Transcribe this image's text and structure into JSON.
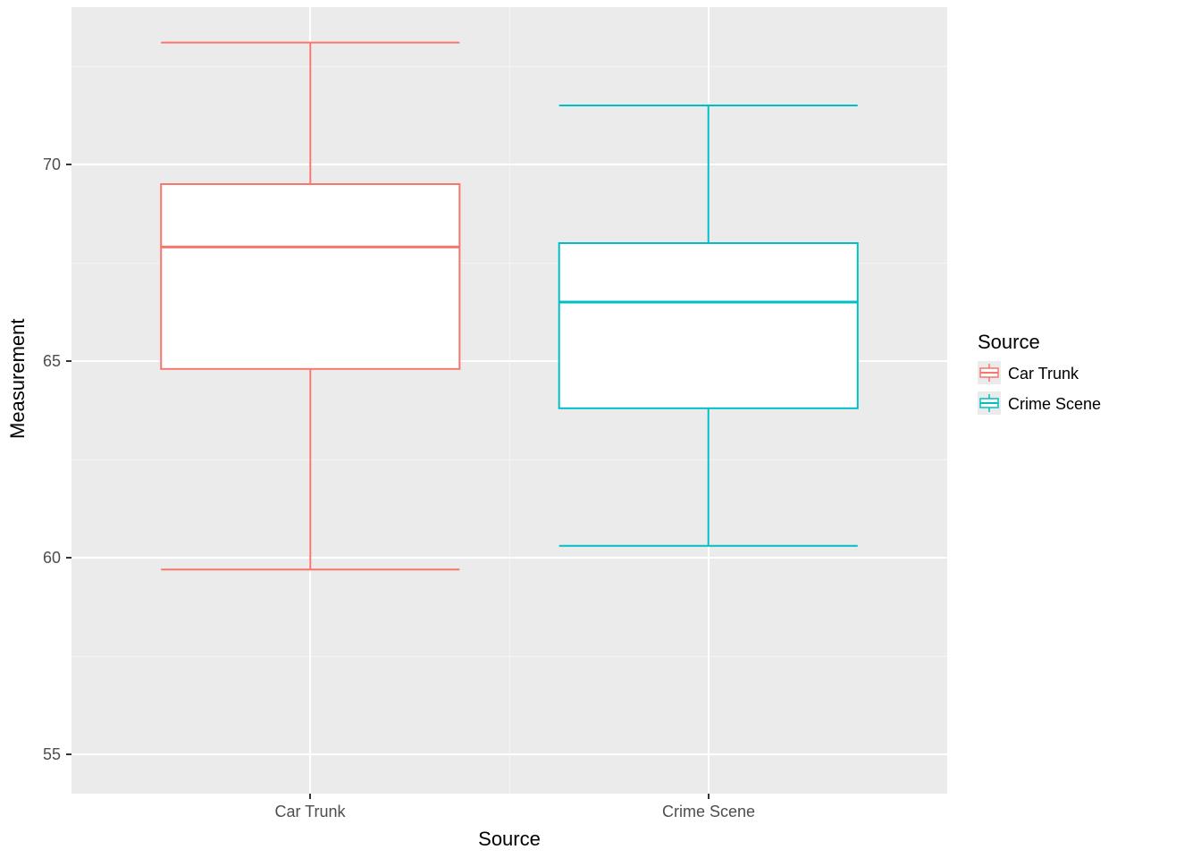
{
  "chart_data": {
    "type": "boxplot",
    "xlabel": "Source",
    "ylabel": "Measurement",
    "categories": [
      "Car Trunk",
      "Crime Scene"
    ],
    "y_ticks": [
      55,
      60,
      65,
      70
    ],
    "ylim": [
      54,
      74
    ],
    "series": [
      {
        "name": "Car Trunk",
        "color": "#f8766d",
        "min": 59.7,
        "q1": 64.8,
        "median": 67.9,
        "q3": 69.5,
        "max": 73.1
      },
      {
        "name": "Crime Scene",
        "color": "#00bfc4",
        "min": 60.3,
        "q1": 63.8,
        "median": 66.5,
        "q3": 68.0,
        "max": 71.5
      }
    ],
    "legend": {
      "title": "Source",
      "items": [
        "Car Trunk",
        "Crime Scene"
      ]
    }
  }
}
